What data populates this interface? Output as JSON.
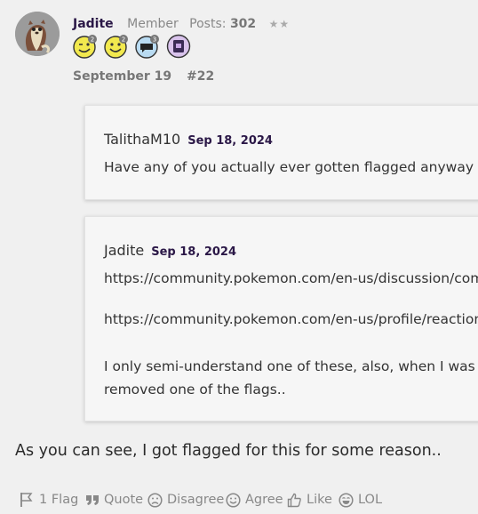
{
  "author": {
    "name": "Jadite",
    "rank": "Member",
    "posts_label": "Posts:",
    "posts_count": "302",
    "stars": "★★"
  },
  "badges": [
    {
      "icon": "wink-emoji-icon",
      "count": "2"
    },
    {
      "icon": "smile-emoji-icon",
      "count": "2"
    },
    {
      "icon": "speech-bubble-icon",
      "count": "3"
    },
    {
      "icon": "purple-book-icon",
      "count": ""
    }
  ],
  "post": {
    "date": "September 19",
    "number": "#22",
    "body": "As you can see, I got flagged for this for some reason.."
  },
  "quotes": [
    {
      "author": "TalithaM10",
      "date": "Sep 18, 2024",
      "lines": [
        "Have any of you actually ever gotten flagged anyway"
      ]
    },
    {
      "author": "Jadite",
      "date": "Sep 18, 2024",
      "lines": [
        "https://community.pokemon.com/en-us/discussion/comm",
        "https://community.pokemon.com/en-us/profile/reactions",
        "I only semi-understand one of these, also, when I was go",
        "removed one of the flags.."
      ]
    }
  ],
  "reactions": {
    "flag": "1 Flag",
    "quote": "Quote",
    "disagree": "Disagree",
    "agree": "Agree",
    "like": "Like",
    "lol": "LOL"
  },
  "colors": {
    "background": "#f0f0f0",
    "quote_bg": "#f6f6f6",
    "author_accent": "#2b1847",
    "muted": "#888888"
  }
}
